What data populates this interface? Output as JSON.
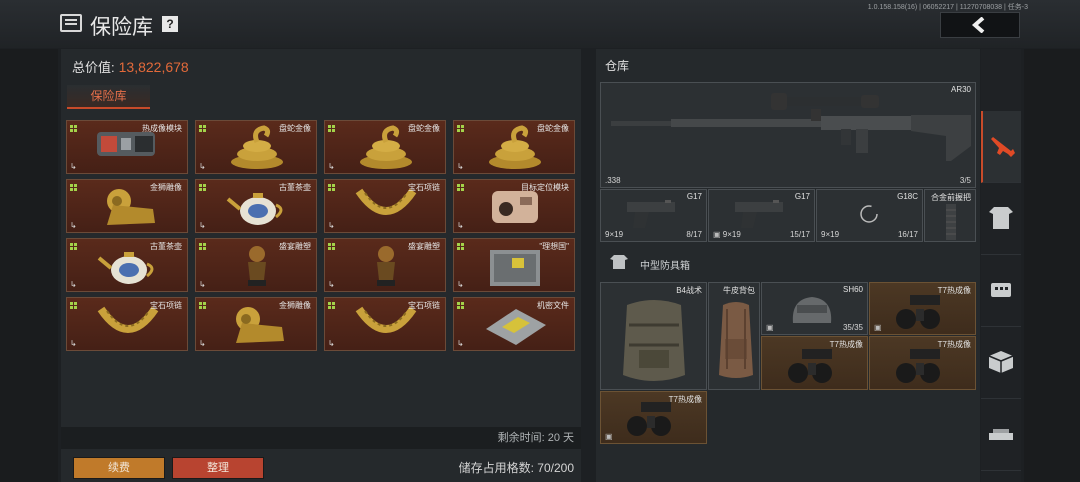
{
  "header": {
    "title": "保险库",
    "help": "?",
    "version": "1.0.158.158(16) | 06052217 | 11270708038 | 任务-3"
  },
  "vault": {
    "total_label": "总价值:",
    "total_value": "13,822,678",
    "tab": "保险库",
    "items": [
      {
        "name": "热成像模块",
        "kind": "thermal"
      },
      {
        "name": "盘蛇金像",
        "kind": "snake"
      },
      {
        "name": "盘蛇金像",
        "kind": "snake"
      },
      {
        "name": "盘蛇金像",
        "kind": "snake"
      },
      {
        "name": "金狮雕像",
        "kind": "lion"
      },
      {
        "name": "古董茶壶",
        "kind": "teapot"
      },
      {
        "name": "宝石项链",
        "kind": "necklace"
      },
      {
        "name": "目标定位模块",
        "kind": "locator"
      },
      {
        "name": "古董茶壶",
        "kind": "teapot"
      },
      {
        "name": "盛宴雕塑",
        "kind": "bust"
      },
      {
        "name": "盛宴雕塑",
        "kind": "bust"
      },
      {
        "name": "\"理想国\"",
        "kind": "box"
      },
      {
        "name": "宝石项链",
        "kind": "necklace"
      },
      {
        "name": "金狮雕像",
        "kind": "lion"
      },
      {
        "name": "宝石项链",
        "kind": "necklace"
      },
      {
        "name": "机密文件",
        "kind": "file"
      }
    ],
    "exit_icon": "↳",
    "remaining": "剩余时间: 20 天",
    "renew_button": "续费",
    "sort_button": "整理",
    "storage": "储存占用格数: 70/200"
  },
  "warehouse": {
    "title": "仓库",
    "rifle": {
      "name": "AR30",
      "caliber": ".338",
      "ammo": "3/5"
    },
    "pistols": [
      {
        "name": "G17",
        "caliber": "9×19",
        "ammo": "8/17"
      },
      {
        "name": "G17",
        "caliber": "9×19",
        "ammo": "15/17"
      },
      {
        "name": "G18C",
        "caliber": "9×19",
        "ammo": "16/17"
      }
    ],
    "grip": {
      "name": "合金前握把"
    },
    "case_label": "中型防具箱",
    "armor": [
      {
        "name": "B4战术"
      },
      {
        "name": "牛皮背包"
      },
      {
        "name": "SH60",
        "durability": "35/35"
      },
      {
        "name": "T7热成像"
      },
      {
        "name": "T7热成像"
      },
      {
        "name": "T7热成像"
      },
      {
        "name": "T7热成像"
      }
    ]
  },
  "colors": {
    "accent": "#c84b2a",
    "gold": "#c9a13b",
    "orange_text": "#e36a3a"
  }
}
